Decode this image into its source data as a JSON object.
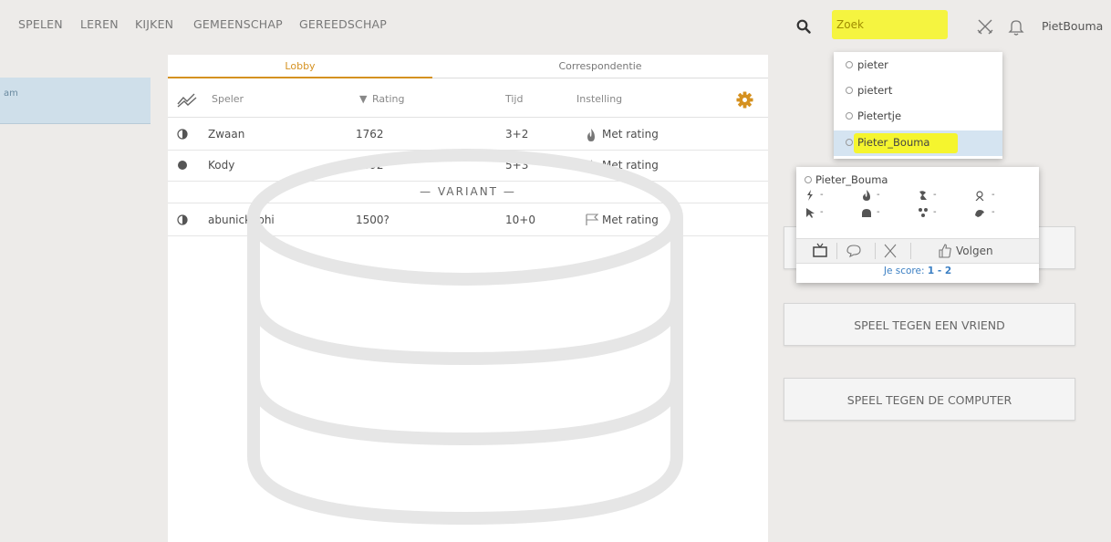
{
  "nav": {
    "items": [
      "SPELEN",
      "LEREN",
      "KIJKEN",
      "GEMEENSCHAP",
      "GEREEDSCHAP"
    ],
    "search_placeholder": "Zoek",
    "username": "PietBouma"
  },
  "sidebar": {
    "tab_label": "am"
  },
  "lobby": {
    "tabs": [
      "Lobby",
      "Correspondentie"
    ],
    "columns": {
      "player": "Speler",
      "rating": "Rating",
      "time": "Tijd",
      "mode": "Instelling"
    },
    "rows": [
      {
        "player": "Zwaan",
        "rating": "1762",
        "time": "3+2",
        "mode": "Met rating",
        "color": "half"
      },
      {
        "player": "Kody",
        "rating": "1592",
        "time": "5+3",
        "mode": "Met rating",
        "color": "black"
      }
    ],
    "variant_label": "— VARIANT —",
    "variant_rows": [
      {
        "player": "abunickabhi",
        "rating": "1500?",
        "time": "10+0",
        "mode": "Met rating",
        "color": "half"
      }
    ]
  },
  "actions": {
    "play_friend": "SPEEL TEGEN EEN VRIEND",
    "play_computer": "SPEEL TEGEN DE COMPUTER"
  },
  "search_dropdown": {
    "items": [
      "pieter",
      "pietert",
      "Pietertje",
      "Pieter_Bouma"
    ],
    "selected_index": 3
  },
  "power_tip": {
    "name": "Pieter_Bouma",
    "ratings": [
      "-",
      "-",
      "-",
      "-",
      "-",
      "-",
      "-",
      "-"
    ],
    "follow_label": "Volgen",
    "score_label": "Je score:",
    "score_value": "1 - 2"
  },
  "colors": {
    "accent": "#d59120",
    "highlight": "#f5f52e",
    "link": "#3b7fc3",
    "selected_bg": "#d5e4f1"
  }
}
